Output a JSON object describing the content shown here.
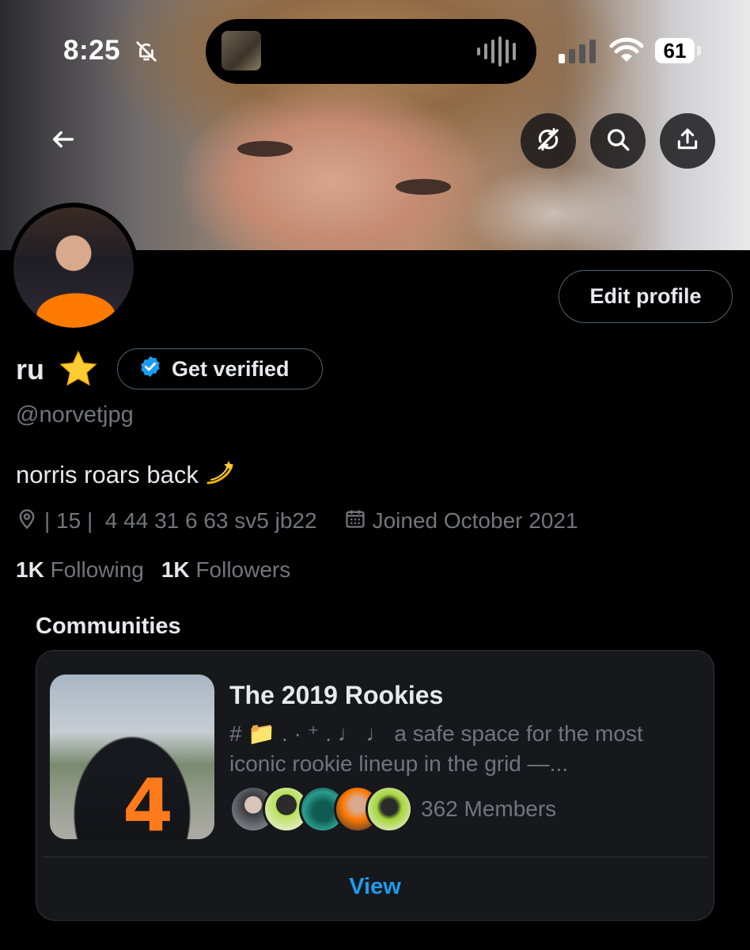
{
  "status_bar": {
    "time": "8:25",
    "battery": "61"
  },
  "profile": {
    "name": "ru",
    "name_emoji": "star",
    "get_verified_label": "Get verified",
    "edit_profile_label": "Edit profile",
    "handle": "@norvetjpg",
    "bio": "norris roars back",
    "bio_emoji": "dizzy",
    "location": "| 15 |  4 44 31 6 63 sv5 jb22",
    "joined": "Joined October 2021",
    "following_count": "1K",
    "following_label": "Following",
    "followers_count": "1K",
    "followers_label": "Followers"
  },
  "communities": {
    "title": "Communities",
    "card": {
      "name": "The 2019 Rookies",
      "description": "# 📁 .  ·  ⁺  . ♩ ♩  a safe space for the most iconic rookie lineup in the grid —...",
      "members": "362 Members",
      "view_label": "View"
    }
  },
  "colors": {
    "accent": "#1d9bf0",
    "background": "#000000",
    "muted_text": "#71767b",
    "card_bg": "#16181c"
  },
  "icons": [
    "back-arrow-icon",
    "sync-off-icon",
    "search-icon",
    "share-icon",
    "location-icon",
    "calendar-icon",
    "verified-badge-icon",
    "bell-muted-icon",
    "wifi-icon",
    "signal-icon",
    "battery-icon"
  ]
}
